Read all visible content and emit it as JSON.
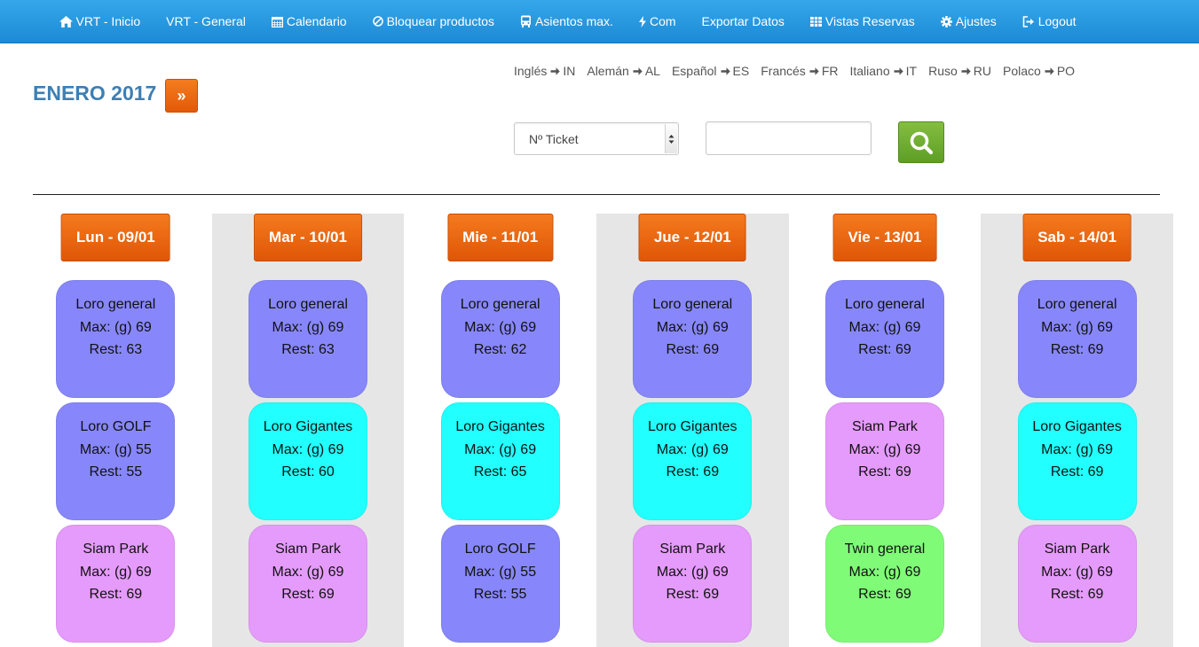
{
  "colors": {
    "nav": "#1c8ad6",
    "orange": "#e8600a",
    "green": "#6aa82f",
    "title": "#3d7fb4",
    "Loro general": "#8787fb",
    "Loro GOLF": "#8787fb",
    "Loro Gigantes": "#22ffff",
    "Siam Park": "#e59bfb",
    "Twin general": "#80fb78"
  },
  "nav": [
    {
      "label": "VRT - Inicio",
      "icon": "home-icon"
    },
    {
      "label": "VRT - General",
      "icon": ""
    },
    {
      "label": "Calendario",
      "icon": "calendar-icon"
    },
    {
      "label": "Bloquear productos",
      "icon": "ban-icon"
    },
    {
      "label": "Asientos max.",
      "icon": "bus-icon"
    },
    {
      "label": "Com",
      "icon": "bolt-icon"
    },
    {
      "label": "Exportar Datos",
      "icon": ""
    },
    {
      "label": "Vistas Reservas",
      "icon": "table-icon"
    },
    {
      "label": "Ajustes",
      "icon": "gear-icon"
    },
    {
      "label": "Logout",
      "icon": "logout-icon"
    }
  ],
  "header": {
    "month_title": "ENERO 2017",
    "next_label": "»"
  },
  "languages": [
    {
      "name": "Inglés",
      "code": "IN"
    },
    {
      "name": "Alemán",
      "code": "AL"
    },
    {
      "name": "Español",
      "code": "ES"
    },
    {
      "name": "Francés",
      "code": "FR"
    },
    {
      "name": "Italiano",
      "code": "IT"
    },
    {
      "name": "Ruso",
      "code": "RU"
    },
    {
      "name": "Polaco",
      "code": "PO"
    }
  ],
  "search": {
    "select_value": "Nº Ticket",
    "input_value": "",
    "input_placeholder": ""
  },
  "days": [
    {
      "label": "Lun - 09/01",
      "cards": [
        {
          "name": "Loro general",
          "max": "Max: (g) 69",
          "rest": "Rest: 63"
        },
        {
          "name": "Loro GOLF",
          "max": "Max: (g) 55",
          "rest": "Rest: 55"
        },
        {
          "name": "Siam Park",
          "max": "Max: (g) 69",
          "rest": "Rest: 69"
        }
      ]
    },
    {
      "label": "Mar - 10/01",
      "cards": [
        {
          "name": "Loro general",
          "max": "Max: (g) 69",
          "rest": "Rest: 63"
        },
        {
          "name": "Loro Gigantes",
          "max": "Max: (g) 69",
          "rest": "Rest: 60"
        },
        {
          "name": "Siam Park",
          "max": "Max: (g) 69",
          "rest": "Rest: 69"
        }
      ]
    },
    {
      "label": "Mie - 11/01",
      "cards": [
        {
          "name": "Loro general",
          "max": "Max: (g) 69",
          "rest": "Rest: 62"
        },
        {
          "name": "Loro Gigantes",
          "max": "Max: (g) 69",
          "rest": "Rest: 65"
        },
        {
          "name": "Loro GOLF",
          "max": "Max: (g) 55",
          "rest": "Rest: 55"
        }
      ]
    },
    {
      "label": "Jue - 12/01",
      "cards": [
        {
          "name": "Loro general",
          "max": "Max: (g) 69",
          "rest": "Rest: 69"
        },
        {
          "name": "Loro Gigantes",
          "max": "Max: (g) 69",
          "rest": "Rest: 69"
        },
        {
          "name": "Siam Park",
          "max": "Max: (g) 69",
          "rest": "Rest: 69"
        }
      ]
    },
    {
      "label": "Vie - 13/01",
      "cards": [
        {
          "name": "Loro general",
          "max": "Max: (g) 69",
          "rest": "Rest: 69"
        },
        {
          "name": "Siam Park",
          "max": "Max: (g) 69",
          "rest": "Rest: 69"
        },
        {
          "name": "Twin general",
          "max": "Max: (g) 69",
          "rest": "Rest: 69"
        }
      ]
    },
    {
      "label": "Sab - 14/01",
      "cards": [
        {
          "name": "Loro general",
          "max": "Max: (g) 69",
          "rest": "Rest: 69"
        },
        {
          "name": "Loro Gigantes",
          "max": "Max: (g) 69",
          "rest": "Rest: 69"
        },
        {
          "name": "Siam Park",
          "max": "Max: (g) 69",
          "rest": "Rest: 69"
        }
      ]
    }
  ]
}
